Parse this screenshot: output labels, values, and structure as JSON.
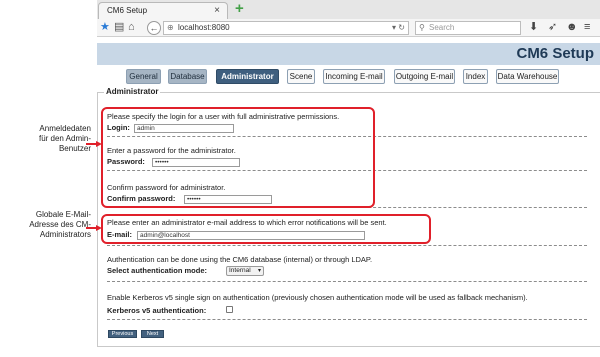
{
  "browser": {
    "tab_title": "CM6 Setup",
    "tab_close": "×",
    "new_tab": "+",
    "url": "localhost:8080",
    "search_placeholder": "Search"
  },
  "page": {
    "title": "CM6 Setup",
    "tabs": [
      {
        "label": "General",
        "state": "shaded"
      },
      {
        "label": "Database",
        "state": "shaded"
      },
      {
        "label": "Administrator",
        "state": "active"
      },
      {
        "label": "Scene",
        "state": "normal"
      },
      {
        "label": "Incoming E-mail",
        "state": "normal"
      },
      {
        "label": "Outgoing E-mail",
        "state": "normal"
      },
      {
        "label": "Index",
        "state": "normal"
      },
      {
        "label": "Data Warehouse",
        "state": "normal"
      }
    ],
    "section_legend": "Administrator"
  },
  "form": {
    "login_intro": "Please specify the login for a user with full administrative permissions.",
    "login_label": "Login:",
    "login_value": "admin",
    "password_intro": "Enter a password for the administrator.",
    "password_label": "Password:",
    "password_value": "••••••",
    "confirm_intro": "Confirm password for administrator.",
    "confirm_label": "Confirm password:",
    "confirm_value": "••••••",
    "email_intro": "Please enter an administrator e-mail address to which error notifications will be sent.",
    "email_label": "E-mail:",
    "email_value": "admin@localhost",
    "auth_intro": "Authentication can be done using the CM6 database (internal) or through LDAP.",
    "auth_label": "Select authentication mode:",
    "auth_value": "Internal",
    "kerberos_intro": "Enable Kerberos v5 single sign on authentication (previously chosen authentication mode will be used as fallback mechanism).",
    "kerberos_label": "Kerberos v5 authentication:",
    "kerberos_checked": false,
    "previous_label": "Previous",
    "next_label": "Next"
  },
  "annotations": {
    "note1_lines": [
      "Anmeldedaten",
      "für den Admin-",
      "Benutzer"
    ],
    "note2_lines": [
      "Globale E-Mail-",
      "Adresse des CM-",
      "Administrators"
    ],
    "highlight_color": "#e0202a"
  },
  "icons": [
    "bookmark-star-icon",
    "clipboard-icon",
    "home-icon",
    "back-arrow-icon",
    "globe-icon",
    "reload-icon",
    "search-icon",
    "download-icon",
    "send-icon",
    "chat-icon",
    "menu-icon"
  ]
}
